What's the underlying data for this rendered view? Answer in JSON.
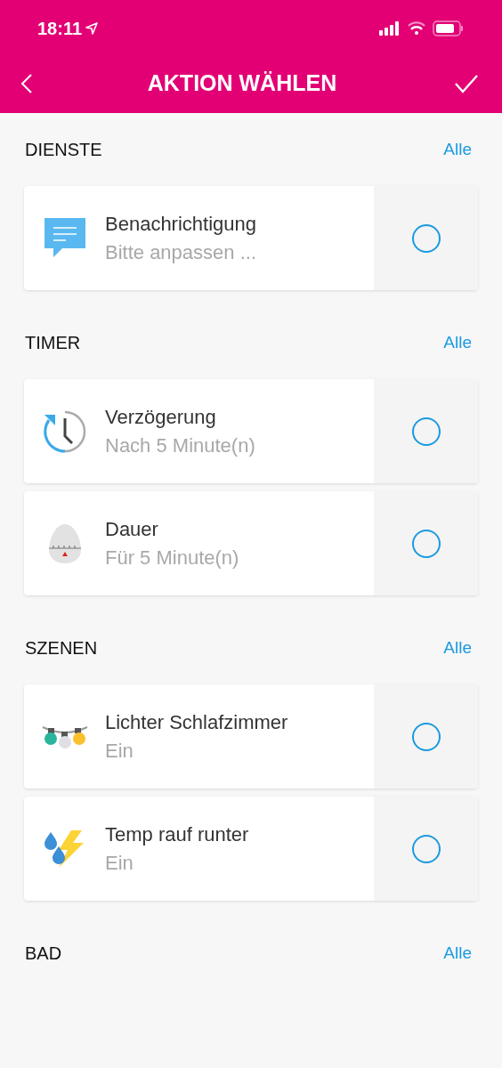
{
  "status_bar": {
    "time": "18:11"
  },
  "nav": {
    "title": "AKTION WÄHLEN"
  },
  "sections": [
    {
      "title": "DIENSTE",
      "link": "Alle",
      "items": [
        {
          "kind": "chat",
          "title": "Benachrichtigung",
          "subtitle": "Bitte anpassen ...",
          "selected": false
        }
      ]
    },
    {
      "title": "TIMER",
      "link": "Alle",
      "items": [
        {
          "kind": "clock",
          "title": "Verzögerung",
          "subtitle": "Nach 5 Minute(n)",
          "selected": false
        },
        {
          "kind": "egg",
          "title": "Dauer",
          "subtitle": "Für 5 Minute(n)",
          "selected": false
        }
      ]
    },
    {
      "title": "SZENEN",
      "link": "Alle",
      "items": [
        {
          "kind": "lights",
          "title": "Lichter Schlafzimmer",
          "subtitle": "Ein",
          "selected": false
        },
        {
          "kind": "weather",
          "title": "Temp rauf runter",
          "subtitle": "Ein",
          "selected": false
        }
      ]
    },
    {
      "title": "BAD",
      "link": "Alle"
    }
  ]
}
